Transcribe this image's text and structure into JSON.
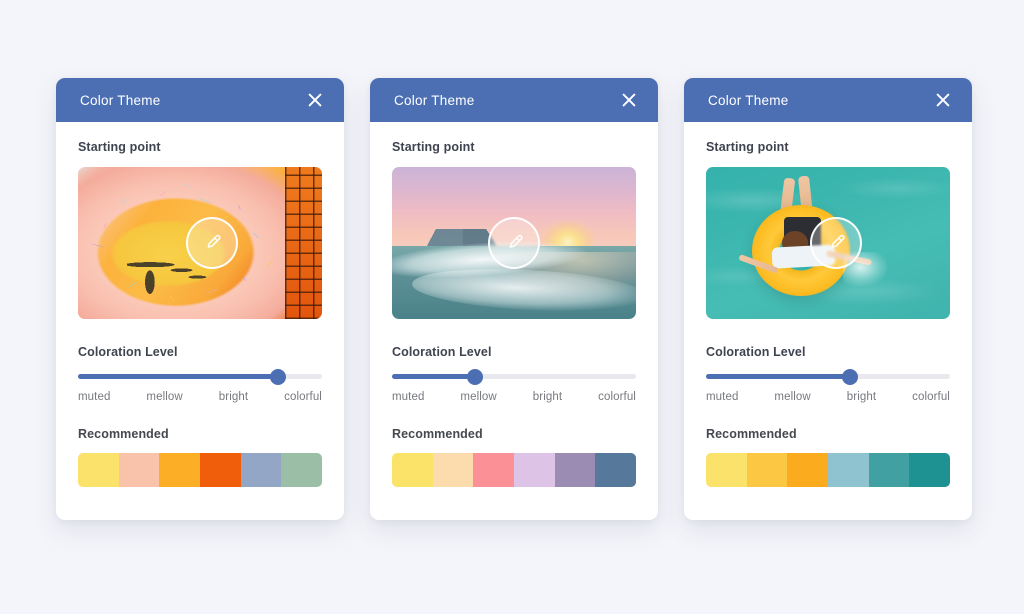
{
  "page": {
    "background_color": "#f4f5fa"
  },
  "theme": {
    "header_color": "#4c6fb4",
    "accent_color": "#4c6fb4",
    "track_color": "#e8e9ee",
    "card_background": "#ffffff"
  },
  "labels": {
    "starting_point": "Starting point",
    "coloration_level": "Coloration Level",
    "recommended": "Recommended",
    "close": "Close"
  },
  "ticks": [
    "muted",
    "mellow",
    "bright",
    "colorful"
  ],
  "cards": [
    {
      "title": "Color Theme",
      "image_subject": "pink donut pool float with sprinkles",
      "slider": {
        "value_label": "colorful",
        "percent": 82
      },
      "swatches": [
        "#fbe26b",
        "#f9c2ab",
        "#fbae26",
        "#f05e0c",
        "#93a6c6",
        "#9bbfa6"
      ]
    },
    {
      "title": "Color Theme",
      "image_subject": "ocean waves at sunset",
      "slider": {
        "value_label": "mellow",
        "percent": 34
      },
      "swatches": [
        "#fbe269",
        "#fcdcac",
        "#fb9097",
        "#ddc3e6",
        "#9b8cb3",
        "#55789b"
      ]
    },
    {
      "title": "Color Theme",
      "image_subject": "person floating on yellow ring in turquoise water",
      "slider": {
        "value_label": "bright",
        "percent": 59
      },
      "swatches": [
        "#fbe26b",
        "#fcc843",
        "#fbab1e",
        "#8ec3cf",
        "#41a0a2",
        "#1e9192"
      ]
    }
  ]
}
